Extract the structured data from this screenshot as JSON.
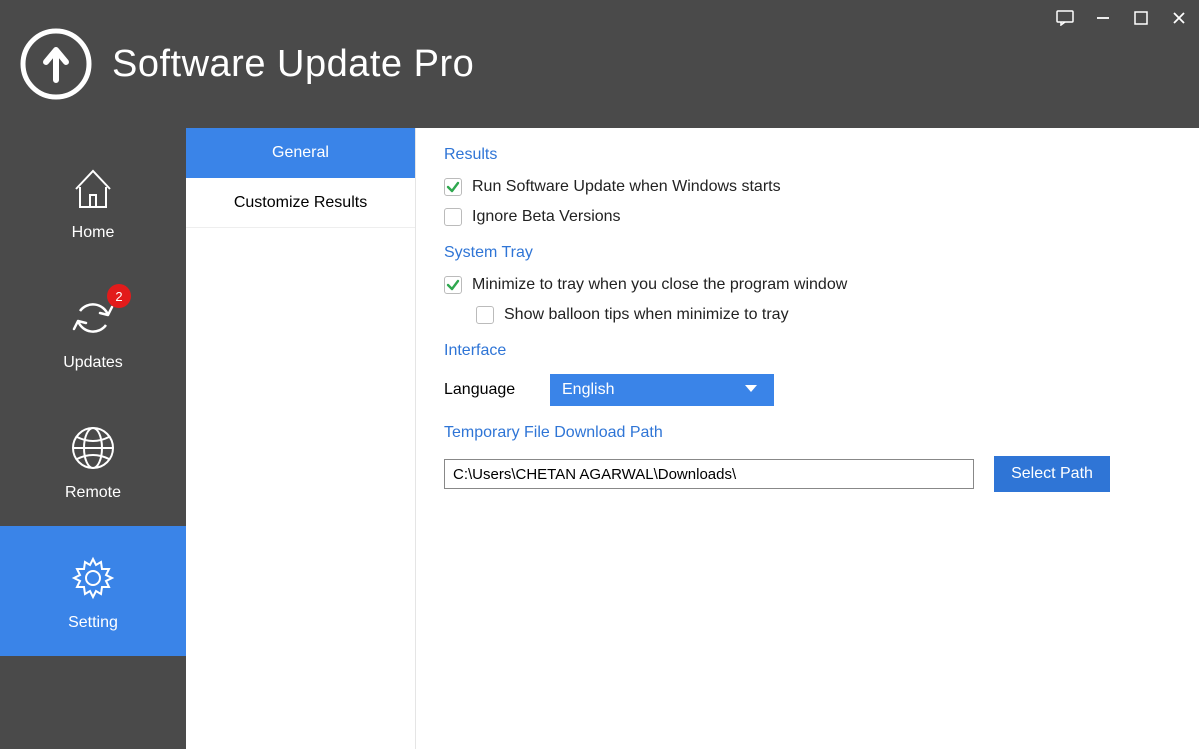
{
  "app": {
    "title": "Software Update Pro"
  },
  "sidebar": {
    "items": [
      {
        "label": "Home"
      },
      {
        "label": "Updates",
        "badge": "2"
      },
      {
        "label": "Remote"
      },
      {
        "label": "Setting"
      }
    ]
  },
  "subnav": {
    "items": [
      {
        "label": "General"
      },
      {
        "label": "Customize Results"
      }
    ]
  },
  "settings": {
    "results": {
      "title": "Results",
      "run_on_start": "Run Software Update when Windows starts",
      "ignore_beta": "Ignore Beta Versions"
    },
    "tray": {
      "title": "System Tray",
      "minimize": "Minimize to tray when you close the program window",
      "balloon": "Show balloon tips when minimize to tray"
    },
    "interface": {
      "title": "Interface",
      "language_label": "Language",
      "language_value": "English"
    },
    "download": {
      "title": "Temporary File Download Path",
      "path": "C:\\Users\\CHETAN AGARWAL\\Downloads\\",
      "button": "Select Path"
    }
  }
}
